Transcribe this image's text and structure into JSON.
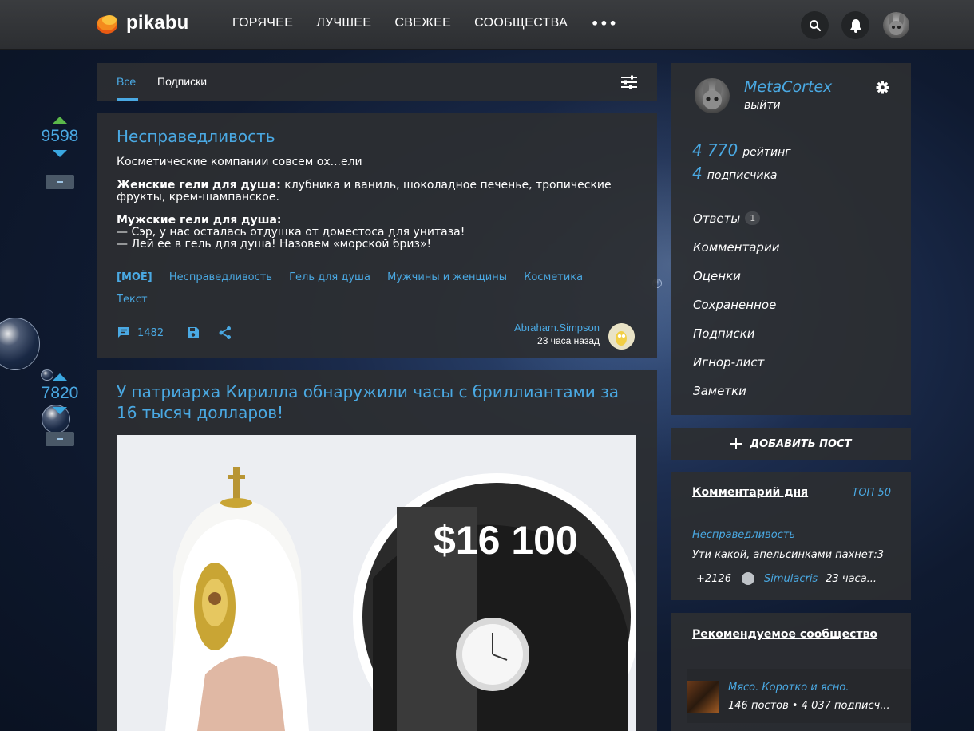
{
  "header": {
    "logo_text": "pikabu",
    "nav": [
      "ГОРЯЧЕЕ",
      "ЛУЧШЕЕ",
      "СВЕЖЕЕ",
      "СООБЩЕСТВА"
    ],
    "more": "•••",
    "icons": [
      "search-icon",
      "bell-icon",
      "user-avatar"
    ]
  },
  "feed_tabs": {
    "all": "Все",
    "subscriptions": "Подписки"
  },
  "votes": [
    {
      "count": "9598"
    },
    {
      "count": "7820"
    }
  ],
  "post1": {
    "title": "Несправедливость",
    "line1": "Косметические компании совсем ох...ели",
    "women_label": "Женские гели для душа:",
    "women_text": " клубника и ваниль, шоколадное печенье, тропические фрукты, крем-шампанское.",
    "men_label": "Мужские гели для душа:",
    "men_line1": "— Сэр, у нас осталась отдушка от доместоса для унитаза!",
    "men_line2": "— Лей ее в гель для душа! Назовем «морской бриз»!",
    "tags": [
      "[МОЁ]",
      "Несправедливость",
      "Гель для душа",
      "Мужчины и женщины",
      "Косметика",
      "Текст"
    ],
    "comments": "1482",
    "author": "Abraham.Simpson",
    "time": "23 часа назад"
  },
  "post2": {
    "title": "У патриарха Кирилла обнаружили часы с бриллиантами за 16 тысяч долларов!",
    "image_text": "$16 100"
  },
  "profile": {
    "name": "MetaCortex",
    "exit": "выйти",
    "rating_num": "4 770",
    "rating_label": "рейтинг",
    "subs_num": "4",
    "subs_label": "подписчика",
    "menu": [
      "Ответы",
      "Комментарии",
      "Оценки",
      "Сохраненное",
      "Подписки",
      "Игнор-лист",
      "Заметки"
    ],
    "answers_badge": "1"
  },
  "add_post": "ДОБАВИТЬ ПОСТ",
  "comment_of_day": {
    "title": "Комментарий дня",
    "top": "ТОП 50",
    "post": "Несправедливость",
    "text": "Ути какой, апельсинками пахнет:3",
    "score": "+2126",
    "user": "Simulacris",
    "time": "23 часа..."
  },
  "recommended": {
    "title": "Рекомендуемое сообщество",
    "name": "Мясо. Коротко и ясно.",
    "stats": "146 постов • 4 037 подписч..."
  },
  "colors": {
    "accent": "#4aa9e3",
    "upvote": "#5bb84a",
    "panel": "#2c2e32"
  }
}
